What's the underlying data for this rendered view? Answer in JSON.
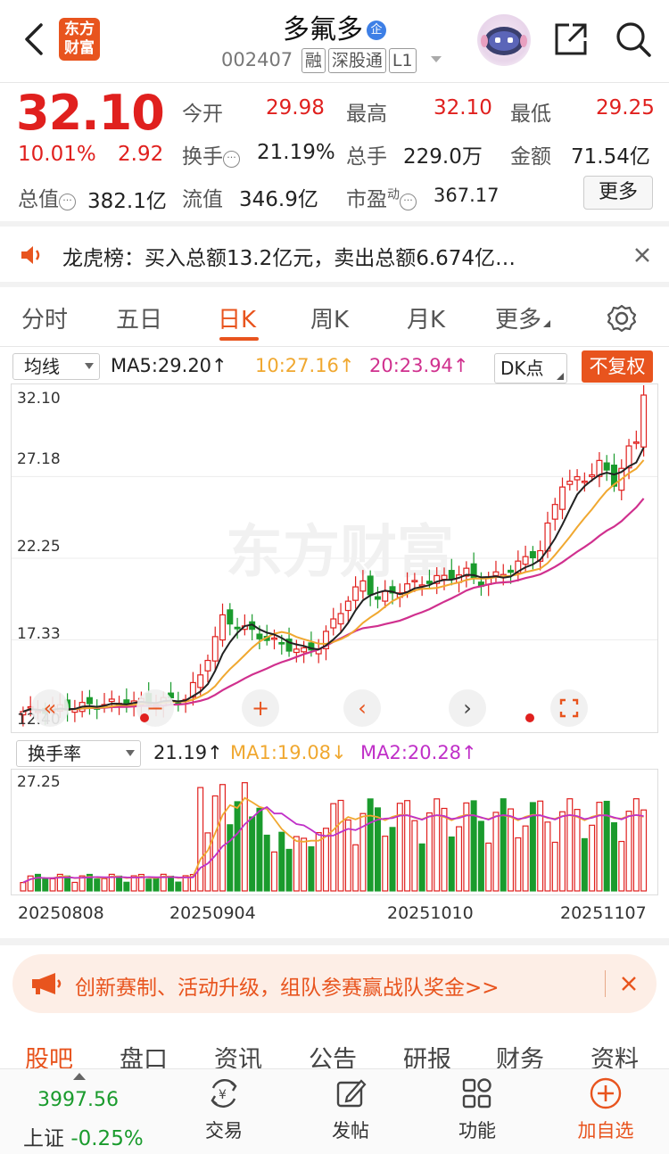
{
  "header": {
    "app_logo_line1": "东方",
    "app_logo_line2": "财富",
    "stock_name": "多氟多",
    "stock_badge": "企",
    "stock_code": "002407",
    "tags": [
      "融",
      "深股通",
      "L1"
    ]
  },
  "quote": {
    "price": "32.10",
    "change_pct": "10.01%",
    "change_amt": "2.92",
    "fields": {
      "open_label": "今开",
      "open": "29.98",
      "high_label": "最高",
      "high": "32.10",
      "low_label": "最低",
      "low": "29.25",
      "turnover_label": "换手",
      "turnover": "21.19%",
      "volume_label": "总手",
      "volume": "229.0万",
      "amount_label": "金额",
      "amount": "71.54亿",
      "mktcap_label": "总值",
      "mktcap": "382.1亿",
      "float_label": "流值",
      "float": "346.9亿",
      "pe_label": "市盈",
      "pe_sup": "动",
      "pe": "367.17"
    },
    "more_button": "更多"
  },
  "notice": {
    "text": "龙虎榜：买入总额13.2亿元，卖出总额6.674亿…"
  },
  "period_tabs": {
    "items": [
      "分时",
      "五日",
      "日K",
      "周K",
      "月K",
      "更多"
    ],
    "active": "日K"
  },
  "kline": {
    "indicator_select": "均线",
    "ma5": "MA5:29.20",
    "ma10": "10:27.16",
    "ma20": "20:23.94",
    "dk_select": "DK点",
    "adjust_button": "不复权",
    "y_ticks": [
      "32.10",
      "27.18",
      "22.25",
      "17.33",
      "12.40"
    ],
    "colors": {
      "up": "#e0201e",
      "down": "#1a9b2d",
      "ma5": "#222222",
      "ma10": "#f0a830",
      "ma20": "#d0308e"
    }
  },
  "volume": {
    "indicator_select": "换手率",
    "value": "21.19",
    "ma1": "MA1:19.08",
    "ma2": "MA2:20.28",
    "y_tick": "27.25",
    "dates": [
      "20250808",
      "20250904",
      "20251010",
      "20251107"
    ]
  },
  "banner": {
    "text": "创新赛制、活动升级，组队参赛赢战队奖金>>"
  },
  "bottom_tabs": {
    "items": [
      "股吧",
      "盘口",
      "资讯",
      "公告",
      "研报",
      "财务",
      "资料"
    ],
    "active": "股吧"
  },
  "dock": {
    "index_value": "3997.56",
    "index_name": "上证",
    "index_change": "-0.25%",
    "items": [
      "交易",
      "发帖",
      "功能",
      "加自选"
    ]
  }
}
